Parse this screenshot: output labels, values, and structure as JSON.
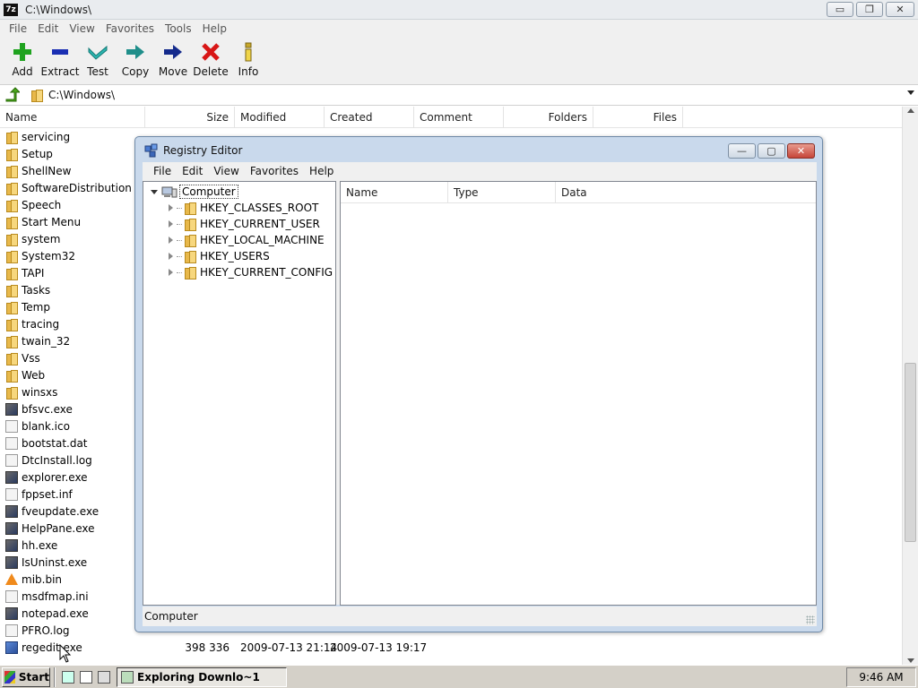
{
  "sevenzip": {
    "title": "C:\\Windows\\",
    "logo_text": "7z",
    "win_buttons": {
      "minimize": "▭",
      "restore": "❐",
      "close": "✕"
    },
    "menu": [
      "File",
      "Edit",
      "View",
      "Favorites",
      "Tools",
      "Help"
    ],
    "toolbar": [
      {
        "label": "Add",
        "icon": "plus-icon",
        "color": "#1fa31f"
      },
      {
        "label": "Extract",
        "icon": "minus-icon",
        "color": "#1a2fb3"
      },
      {
        "label": "Test",
        "icon": "check-icon",
        "color": "#2bb5b0"
      },
      {
        "label": "Copy",
        "icon": "copy-arrow-icon",
        "color": "#1f8e8a"
      },
      {
        "label": "Move",
        "icon": "move-arrow-icon",
        "color": "#142a8c"
      },
      {
        "label": "Delete",
        "icon": "delete-x-icon",
        "color": "#d81616"
      },
      {
        "label": "Info",
        "icon": "info-icon",
        "color": "#c8a82a"
      }
    ],
    "address": "C:\\Windows\\",
    "columns": [
      "Name",
      "Size",
      "Modified",
      "Created",
      "Comment",
      "Folders",
      "Files"
    ],
    "rows": [
      {
        "name": "servicing",
        "type": "folder",
        "size": "",
        "modified": "",
        "created": ""
      },
      {
        "name": "Setup",
        "type": "folder",
        "size": "",
        "modified": "",
        "created": ""
      },
      {
        "name": "ShellNew",
        "type": "folder",
        "size": "",
        "modified": "",
        "created": ""
      },
      {
        "name": "SoftwareDistribution",
        "type": "folder",
        "size": "",
        "modified": "",
        "created": ""
      },
      {
        "name": "Speech",
        "type": "folder",
        "size": "",
        "modified": "",
        "created": ""
      },
      {
        "name": "Start Menu",
        "type": "folder",
        "size": "",
        "modified": "",
        "created": ""
      },
      {
        "name": "system",
        "type": "folder",
        "size": "",
        "modified": "",
        "created": ""
      },
      {
        "name": "System32",
        "type": "folder",
        "size": "",
        "modified": "",
        "created": ""
      },
      {
        "name": "TAPI",
        "type": "folder",
        "size": "",
        "modified": "",
        "created": ""
      },
      {
        "name": "Tasks",
        "type": "folder",
        "size": "",
        "modified": "",
        "created": ""
      },
      {
        "name": "Temp",
        "type": "folder",
        "size": "",
        "modified": "",
        "created": ""
      },
      {
        "name": "tracing",
        "type": "folder",
        "size": "",
        "modified": "",
        "created": ""
      },
      {
        "name": "twain_32",
        "type": "folder",
        "size": "",
        "modified": "",
        "created": ""
      },
      {
        "name": "Vss",
        "type": "folder",
        "size": "",
        "modified": "",
        "created": ""
      },
      {
        "name": "Web",
        "type": "folder",
        "size": "",
        "modified": "",
        "created": ""
      },
      {
        "name": "winsxs",
        "type": "folder",
        "size": "",
        "modified": "",
        "created": ""
      },
      {
        "name": "bfsvc.exe",
        "type": "exe",
        "size": "",
        "modified": "",
        "created": ""
      },
      {
        "name": "blank.ico",
        "type": "doc",
        "size": "",
        "modified": "",
        "created": ""
      },
      {
        "name": "bootstat.dat",
        "type": "doc",
        "size": "",
        "modified": "",
        "created": ""
      },
      {
        "name": "DtcInstall.log",
        "type": "doc",
        "size": "",
        "modified": "",
        "created": ""
      },
      {
        "name": "explorer.exe",
        "type": "exe",
        "size": "",
        "modified": "",
        "created": ""
      },
      {
        "name": "fppset.inf",
        "type": "doc",
        "size": "",
        "modified": "",
        "created": ""
      },
      {
        "name": "fveupdate.exe",
        "type": "exe",
        "size": "",
        "modified": "",
        "created": ""
      },
      {
        "name": "HelpPane.exe",
        "type": "exe",
        "size": "",
        "modified": "",
        "created": ""
      },
      {
        "name": "hh.exe",
        "type": "exe",
        "size": "",
        "modified": "",
        "created": ""
      },
      {
        "name": "IsUninst.exe",
        "type": "exe",
        "size": "",
        "modified": "",
        "created": ""
      },
      {
        "name": "mib.bin",
        "type": "cone",
        "size": "",
        "modified": "",
        "created": ""
      },
      {
        "name": "msdfmap.ini",
        "type": "doc",
        "size": "",
        "modified": "",
        "created": ""
      },
      {
        "name": "notepad.exe",
        "type": "exe",
        "size": "",
        "modified": "",
        "created": ""
      },
      {
        "name": "PFRO.log",
        "type": "doc",
        "size": "",
        "modified": "",
        "created": ""
      },
      {
        "name": "regedit.exe",
        "type": "reg",
        "size": "398 336",
        "modified": "2009-07-13 21:14",
        "created": "2009-07-13 19:17"
      }
    ]
  },
  "regedit": {
    "title": "Registry Editor",
    "win_buttons": {
      "minimize": "—",
      "restore": "▢",
      "close": "✕"
    },
    "menu": [
      "File",
      "Edit",
      "View",
      "Favorites",
      "Help"
    ],
    "tree_root": "Computer",
    "tree_children": [
      "HKEY_CLASSES_ROOT",
      "HKEY_CURRENT_USER",
      "HKEY_LOCAL_MACHINE",
      "HKEY_USERS",
      "HKEY_CURRENT_CONFIG"
    ],
    "columns": [
      "Name",
      "Type",
      "Data"
    ],
    "status": "Computer"
  },
  "taskbar": {
    "start_label": "Start",
    "task_label": "Exploring Downlo~1",
    "clock": "9:46 AM"
  }
}
